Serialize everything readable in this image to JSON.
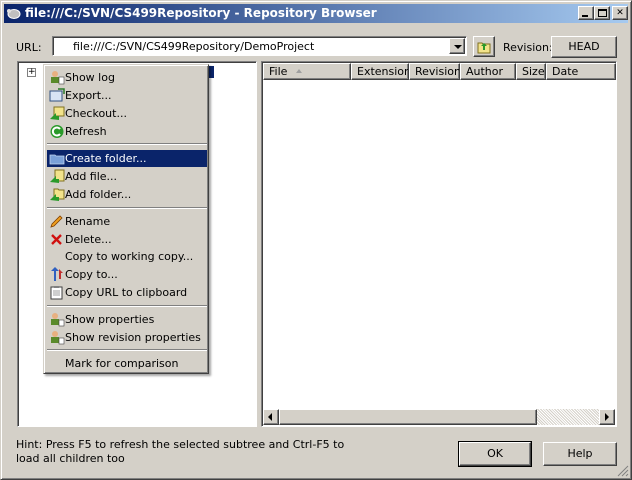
{
  "window": {
    "title": "file:///C:/SVN/CS499Repository - Repository Browser"
  },
  "toolbar": {
    "url_label": "URL:",
    "url_value": "file:///C:/SVN/CS499Repository/DemoProject",
    "revision_label": "Revision:",
    "revision_button": "HEAD"
  },
  "list": {
    "columns": [
      "File",
      "Extension",
      "Revision",
      "Author",
      "Size",
      "Date"
    ]
  },
  "context_menu": {
    "groups": [
      [
        {
          "label": "Show log",
          "icon": "show-log-icon"
        },
        {
          "label": "Export...",
          "icon": "export-icon"
        },
        {
          "label": "Checkout...",
          "icon": "checkout-icon"
        },
        {
          "label": "Refresh",
          "icon": "refresh-icon"
        }
      ],
      [
        {
          "label": "Create folder...",
          "icon": "create-folder-icon",
          "highlighted": true
        },
        {
          "label": "Add file...",
          "icon": "add-file-icon"
        },
        {
          "label": "Add folder...",
          "icon": "add-folder-icon"
        }
      ],
      [
        {
          "label": "Rename",
          "icon": "rename-icon"
        },
        {
          "label": "Delete...",
          "icon": "delete-icon"
        },
        {
          "label": "Copy to working copy...",
          "icon": ""
        },
        {
          "label": "Copy to...",
          "icon": "copy-to-icon"
        },
        {
          "label": "Copy URL to clipboard",
          "icon": "clipboard-icon"
        }
      ],
      [
        {
          "label": "Show properties",
          "icon": "properties-icon"
        },
        {
          "label": "Show revision properties",
          "icon": "revision-properties-icon"
        }
      ],
      [
        {
          "label": "Mark for comparison",
          "icon": ""
        }
      ]
    ]
  },
  "footer": {
    "hint": "Hint: Press F5 to refresh the selected subtree and Ctrl-F5 to load all children too",
    "ok": "OK",
    "help": "Help"
  },
  "colors": {
    "title_start": "#0a246a",
    "title_end": "#a6caf0",
    "highlight": "#0a246a",
    "face": "#d4d0c8"
  }
}
